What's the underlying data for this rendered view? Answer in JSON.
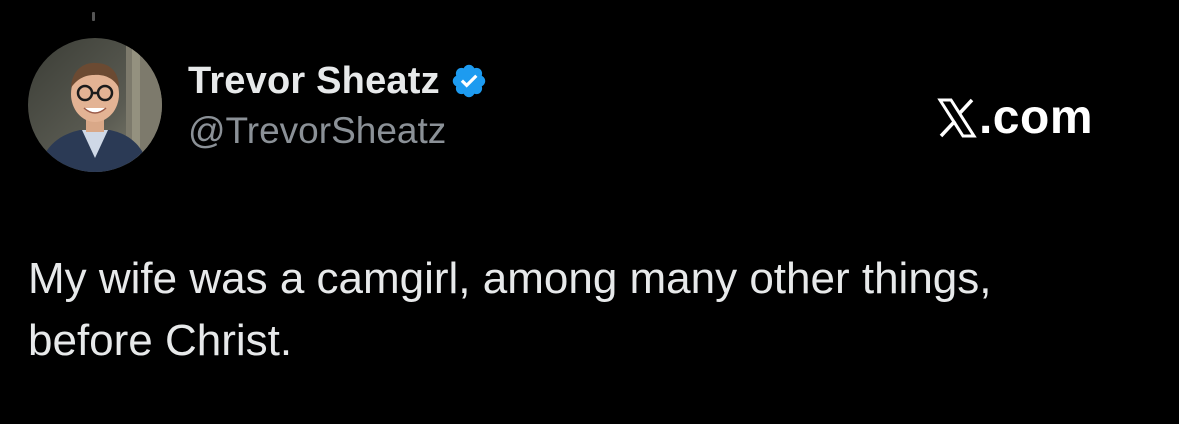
{
  "tweet": {
    "author": {
      "display_name": "Trevor Sheatz",
      "handle": "@TrevorSheatz",
      "verified": true,
      "avatar_icon": "user-photo-avatar"
    },
    "site_mark": {
      "logo_icon": "x-logo-icon",
      "text": ".com"
    },
    "body_lines": [
      "My wife was a camgirl, among many other things,",
      "before Christ."
    ]
  },
  "colors": {
    "background": "#000000",
    "primary_text": "#e7e9ea",
    "secondary_text": "#8b9197",
    "verified_blue": "#1d9bf0"
  }
}
